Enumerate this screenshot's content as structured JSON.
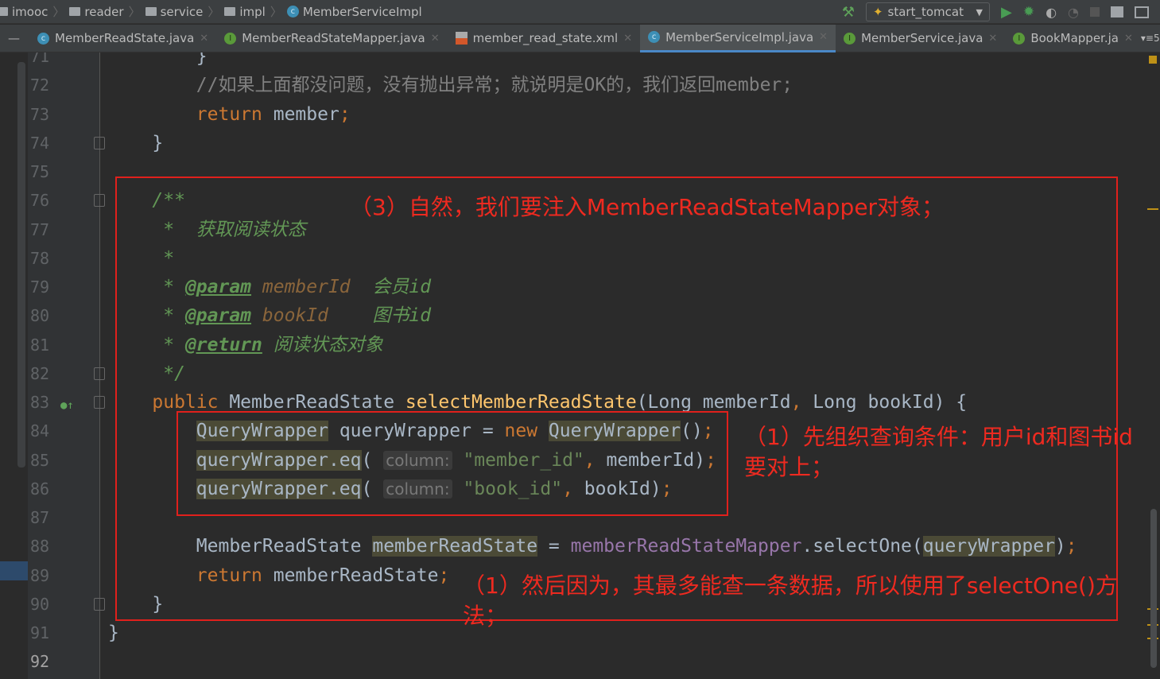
{
  "breadcrumb": [
    "imooc",
    "reader",
    "service",
    "impl",
    "MemberServiceImpl"
  ],
  "toolbar": {
    "run_config": "start_tomcat"
  },
  "tabs": [
    {
      "label": "MemberReadState.java",
      "icon": "class-icon",
      "active": false
    },
    {
      "label": "MemberReadStateMapper.java",
      "icon": "interface-icon",
      "active": false
    },
    {
      "label": "member_read_state.xml",
      "icon": "xml-icon",
      "active": false
    },
    {
      "label": "MemberServiceImpl.java",
      "icon": "class-icon",
      "active": true
    },
    {
      "label": "MemberService.java",
      "icon": "interface-icon",
      "active": false
    },
    {
      "label": "BookMapper.ja",
      "icon": "interface-icon",
      "active": false
    }
  ],
  "tab_overflow": "5",
  "colors": {
    "accent": "#4a88c7",
    "annotation": "#ee2a20"
  },
  "code_lines": [
    {
      "n": "71",
      "indent": 2,
      "t": [
        [
          "",
          "}"
        ]
      ]
    },
    {
      "n": "72",
      "indent": 2,
      "t": [
        [
          "cm",
          "//如果上面都没问题，没有抛出异常；就说明是OK的，我们返回member;"
        ]
      ]
    },
    {
      "n": "73",
      "indent": 2,
      "t": [
        [
          "kw",
          "return "
        ],
        [
          "",
          "member"
        ],
        [
          "kw",
          ";"
        ]
      ]
    },
    {
      "n": "74",
      "indent": 1,
      "t": [
        [
          "",
          "}"
        ]
      ]
    },
    {
      "n": "75",
      "indent": 0,
      "t": []
    },
    {
      "n": "76",
      "indent": 1,
      "t": [
        [
          "doc",
          "/**"
        ]
      ]
    },
    {
      "n": "77",
      "indent": 1,
      "t": [
        [
          "doc",
          " *  获取阅读状态"
        ]
      ]
    },
    {
      "n": "78",
      "indent": 1,
      "t": [
        [
          "doc",
          " *"
        ]
      ]
    },
    {
      "n": "79",
      "indent": 1,
      "t": [
        [
          "doc",
          " * "
        ],
        [
          "tag",
          "@param"
        ],
        [
          "dparam",
          " memberId "
        ],
        [
          "doc",
          " 会员id"
        ]
      ]
    },
    {
      "n": "80",
      "indent": 1,
      "t": [
        [
          "doc",
          " * "
        ],
        [
          "tag",
          "@param"
        ],
        [
          "dparam",
          " bookId"
        ],
        [
          "doc",
          "    图书id"
        ]
      ]
    },
    {
      "n": "81",
      "indent": 1,
      "t": [
        [
          "doc",
          " * "
        ],
        [
          "tag",
          "@return"
        ],
        [
          "doc",
          " 阅读状态对象"
        ]
      ]
    },
    {
      "n": "82",
      "indent": 1,
      "t": [
        [
          "doc",
          " */"
        ]
      ]
    },
    {
      "n": "83",
      "indent": 1,
      "t": [
        [
          "kw",
          "public "
        ],
        [
          "",
          "MemberReadState "
        ],
        [
          "fn",
          "selectMemberReadState"
        ],
        [
          "",
          "(Long memberId"
        ],
        [
          "kw",
          ", "
        ],
        [
          "",
          "Long bookId) {"
        ]
      ]
    },
    {
      "n": "84",
      "indent": 2,
      "t": [
        [
          "hl",
          "QueryWrapper"
        ],
        [
          "",
          " queryWrapper = "
        ],
        [
          "kw",
          "new "
        ],
        [
          "hl",
          "QueryWrapper"
        ],
        [
          "",
          "()"
        ],
        [
          "kw",
          ";"
        ]
      ]
    },
    {
      "n": "85",
      "indent": 2,
      "t": [
        [
          "hl",
          "queryWrapper.eq"
        ],
        [
          "",
          "( "
        ],
        [
          "hint",
          "column:"
        ],
        [
          "str",
          " \"member_id\""
        ],
        [
          "kw",
          ", "
        ],
        [
          "",
          "memberId)"
        ],
        [
          "kw",
          ";"
        ]
      ]
    },
    {
      "n": "86",
      "indent": 2,
      "t": [
        [
          "hl",
          "queryWrapper.eq"
        ],
        [
          "",
          "( "
        ],
        [
          "hint",
          "column:"
        ],
        [
          "str",
          " \"book_id\""
        ],
        [
          "kw",
          ", "
        ],
        [
          "",
          "bookId)"
        ],
        [
          "kw",
          ";"
        ]
      ]
    },
    {
      "n": "87",
      "indent": 0,
      "t": []
    },
    {
      "n": "88",
      "indent": 2,
      "t": [
        [
          "",
          "MemberReadState "
        ],
        [
          "hl",
          "memberReadState"
        ],
        [
          "",
          " = "
        ],
        [
          "fld",
          "memberReadStateMapper"
        ],
        [
          "",
          ".selectOne("
        ],
        [
          "hl",
          "queryWrapper"
        ],
        [
          "",
          ")"
        ],
        [
          "kw",
          ";"
        ]
      ]
    },
    {
      "n": "89",
      "indent": 2,
      "t": [
        [
          "kw",
          "return "
        ],
        [
          "",
          "memberReadState"
        ],
        [
          "kw",
          ";"
        ]
      ]
    },
    {
      "n": "90",
      "indent": 1,
      "t": [
        [
          "",
          "}"
        ]
      ]
    },
    {
      "n": "91",
      "indent": 0,
      "t": [
        [
          "",
          "}"
        ]
      ]
    },
    {
      "n": "92",
      "indent": 0,
      "t": []
    }
  ],
  "annotations": {
    "inject": "（3）自然，我们要注入MemberReadStateMapper对象；",
    "condition": "（1）先组织查询条件：用户id和图书id要对上；",
    "select_one": "（1）然后因为，其最多能查一条数据，所以使用了selectOne()方法；"
  }
}
